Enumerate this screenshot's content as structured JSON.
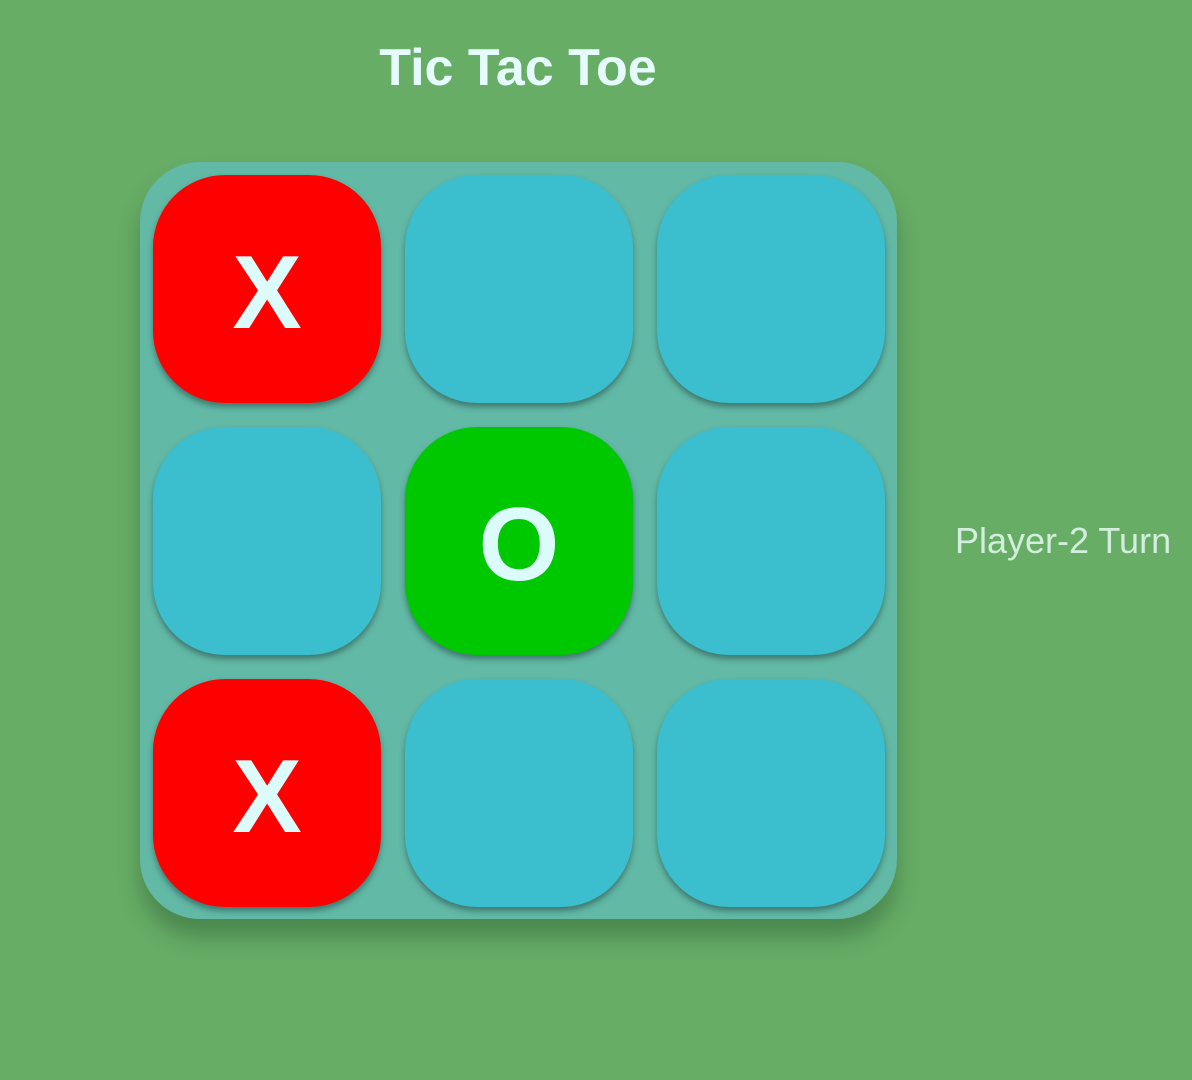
{
  "game": {
    "title": "Tic Tac Toe",
    "status": "Player-2 Turn",
    "cells": [
      {
        "mark": "X",
        "state": "x"
      },
      {
        "mark": "",
        "state": "empty"
      },
      {
        "mark": "",
        "state": "empty"
      },
      {
        "mark": "",
        "state": "empty"
      },
      {
        "mark": "O",
        "state": "o"
      },
      {
        "mark": "",
        "state": "empty"
      },
      {
        "mark": "X",
        "state": "x"
      },
      {
        "mark": "",
        "state": "empty"
      },
      {
        "mark": "",
        "state": "empty"
      }
    ]
  },
  "colors": {
    "background": "#67ad66",
    "board": "#62b9a6",
    "empty_cell": "#3bbece",
    "x_cell": "#ff0000",
    "o_cell": "#00c800",
    "mark_text": "#dcfcfc"
  }
}
